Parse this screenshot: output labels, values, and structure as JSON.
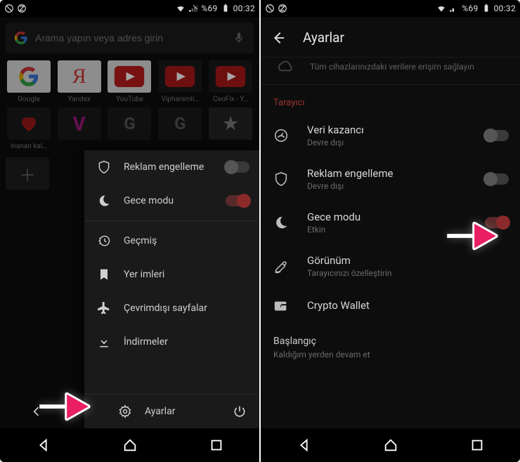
{
  "status": {
    "battery_pct": "%69",
    "time": "00:32"
  },
  "left": {
    "search_placeholder": "Arama yapın veya adres girin",
    "tiles": [
      {
        "label": "Google"
      },
      {
        "label": "Yandex"
      },
      {
        "label": "YouTube"
      },
      {
        "label": "Viphanimli…"
      },
      {
        "label": "CeoFix - Y…"
      },
      {
        "label": "inanan kal…"
      }
    ],
    "menu": {
      "ad_block": "Reklam engelleme",
      "night_mode": "Gece modu",
      "history": "Geçmiş",
      "bookmarks": "Yer imleri",
      "offline": "Çevrimdışı sayfalar",
      "downloads": "İndirmeler",
      "settings": "Ayarlar"
    }
  },
  "right": {
    "header_title": "Ayarlar",
    "sync_sub": "Tüm cihazlarınızdaki verilere erişim sağlayın",
    "section_browser": "Tarayıcı",
    "rows": {
      "data_savings": {
        "title": "Veri kazancı",
        "sub": "Devre dışı"
      },
      "ad_block": {
        "title": "Reklam engelleme",
        "sub": "Devre dışı"
      },
      "night_mode": {
        "title": "Gece modu",
        "sub": "Etkin"
      },
      "appearance": {
        "title": "Görünüm",
        "sub": "Tarayıcınızı özelleştirin"
      },
      "crypto": {
        "title": "Crypto Wallet"
      }
    },
    "startup_title": "Başlangıç",
    "startup_sub": "Kaldığım yerden devam et"
  }
}
